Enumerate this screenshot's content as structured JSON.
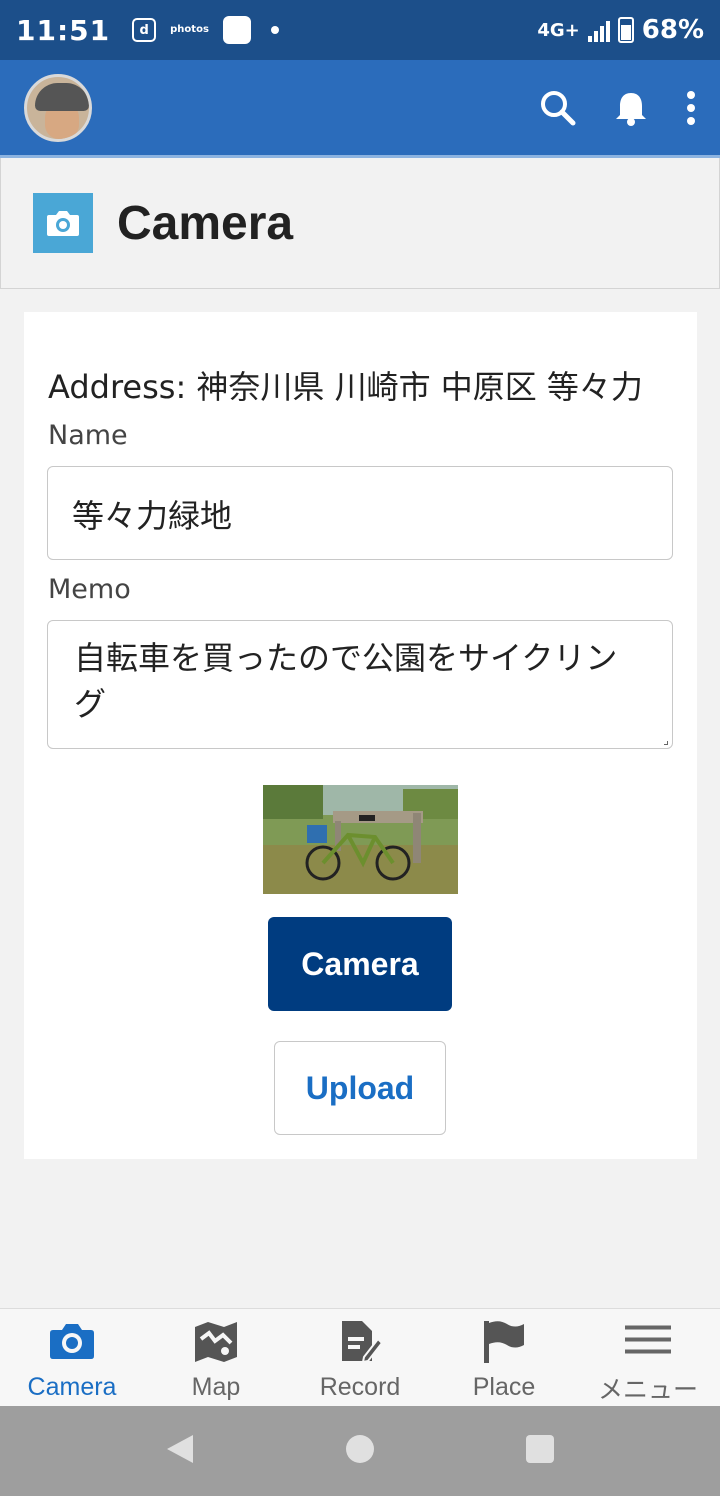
{
  "status_bar": {
    "time": "11:51",
    "app_icons": [
      "d",
      "photos"
    ],
    "network": "4G+",
    "battery_percent": "68%"
  },
  "header": {
    "avatar": "user-avatar",
    "actions": [
      "search-icon",
      "bell-icon",
      "more-vertical-icon"
    ]
  },
  "page": {
    "title": "Camera",
    "icon": "camera-icon",
    "icon_color": "#4aa7d6"
  },
  "form": {
    "address": "Address: 神奈川県 川崎市 中原区 等々力",
    "name_label": "Name",
    "name_value": "等々力緑地",
    "memo_label": "Memo",
    "memo_value": "自転車を買ったので公園をサイクリング",
    "photo": "bicycle-photo-thumbnail"
  },
  "buttons": {
    "camera": "Camera",
    "upload": "Upload",
    "primary_color": "#003c80",
    "link_color": "#1a6ec4"
  },
  "bottom_nav": {
    "items": [
      {
        "label": "Camera",
        "icon": "camera-icon",
        "active": true
      },
      {
        "label": "Map",
        "icon": "map-icon",
        "active": false
      },
      {
        "label": "Record",
        "icon": "record-icon",
        "active": false
      },
      {
        "label": "Place",
        "icon": "flag-icon",
        "active": false
      },
      {
        "label": "メニュー",
        "icon": "hamburger-menu-icon",
        "active": false
      }
    ]
  },
  "system_nav": [
    "back-icon",
    "home-icon",
    "recents-icon"
  ]
}
